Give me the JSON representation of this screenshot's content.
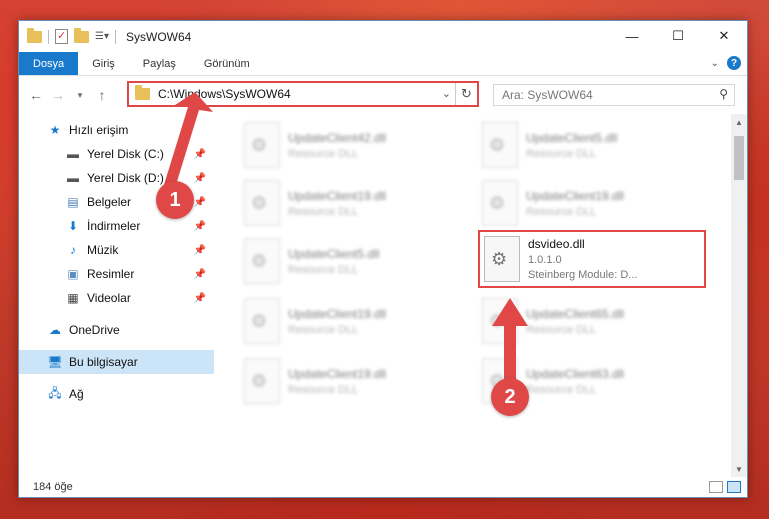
{
  "window": {
    "title": "SysWOW64",
    "controls": {
      "minimize": "—",
      "maximize": "☐",
      "close": "✕"
    }
  },
  "ribbon": {
    "tabs": [
      "Dosya",
      "Giriş",
      "Paylaş",
      "Görünüm"
    ],
    "active_tab": "Dosya"
  },
  "navigation": {
    "address_path": "C:\\Windows\\SysWOW64",
    "search_placeholder": "Ara: SysWOW64"
  },
  "sidebar": {
    "quick_access": "Hızlı erişim",
    "items": [
      {
        "label": "Yerel Disk (C:)",
        "icon": "drive-icon",
        "pinned": true
      },
      {
        "label": "Yerel Disk (D:)",
        "icon": "drive-icon",
        "pinned": true
      },
      {
        "label": "Belgeler",
        "icon": "documents-icon",
        "pinned": true
      },
      {
        "label": "İndirmeler",
        "icon": "download-icon",
        "pinned": true
      },
      {
        "label": "Müzik",
        "icon": "music-icon",
        "pinned": true
      },
      {
        "label": "Resimler",
        "icon": "pictures-icon",
        "pinned": true
      },
      {
        "label": "Videolar",
        "icon": "video-icon",
        "pinned": true
      }
    ],
    "onedrive": "OneDrive",
    "this_pc": "Bu bilgisayar",
    "network": "Ağ"
  },
  "files": [
    {
      "name": "UpdateClient42.dll",
      "sub": "Resource DLL"
    },
    {
      "name": "UpdateClient5.dll",
      "sub": "Resource DLL"
    },
    {
      "name": "UpdateClient19.dll",
      "sub": "Resource DLL"
    },
    {
      "name": "UpdateClient19.dll",
      "sub": "Resource DLL"
    },
    {
      "name": "UpdateClient5.dll",
      "sub": "Resource DLL"
    },
    {
      "name": "UpdateClient19.dll",
      "sub": "Resource DLL"
    },
    {
      "name": "UpdateClient65.dll",
      "sub": "Resource DLL"
    },
    {
      "name": "UpdateClient19.dll",
      "sub": "Resource DLL"
    },
    {
      "name": "UpdateClient63.dll",
      "sub": "Resource DLL"
    }
  ],
  "highlighted_file": {
    "name": "dsvideo.dll",
    "version": "1.0.1.0",
    "description": "Steinberg Module: D..."
  },
  "status": {
    "item_count": "184 öğe"
  },
  "annotations": {
    "step1": "1",
    "step2": "2",
    "color": "#e04848"
  }
}
